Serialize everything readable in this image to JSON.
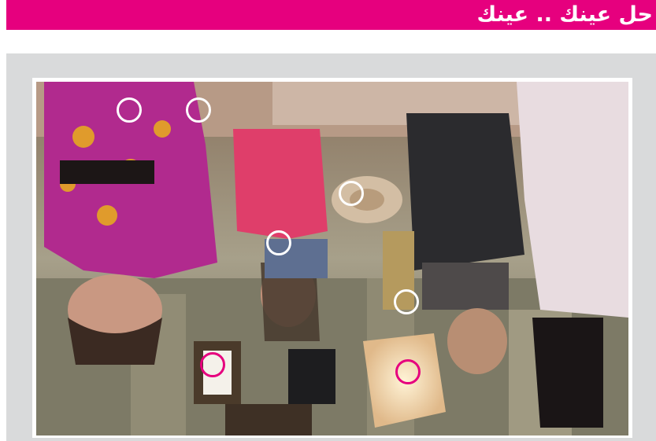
{
  "game": {
    "title": "حل عينك .. عينك",
    "accent_color": "#e6007e"
  },
  "puzzle": {
    "image_description_icon": "scene-photo",
    "markers": [
      {
        "id": "difference-1",
        "state": "unfound"
      },
      {
        "id": "difference-2",
        "state": "unfound"
      },
      {
        "id": "difference-3",
        "state": "unfound"
      },
      {
        "id": "difference-4",
        "state": "unfound"
      },
      {
        "id": "difference-5",
        "state": "unfound"
      },
      {
        "id": "difference-6",
        "state": "found"
      },
      {
        "id": "difference-7",
        "state": "found"
      }
    ]
  }
}
